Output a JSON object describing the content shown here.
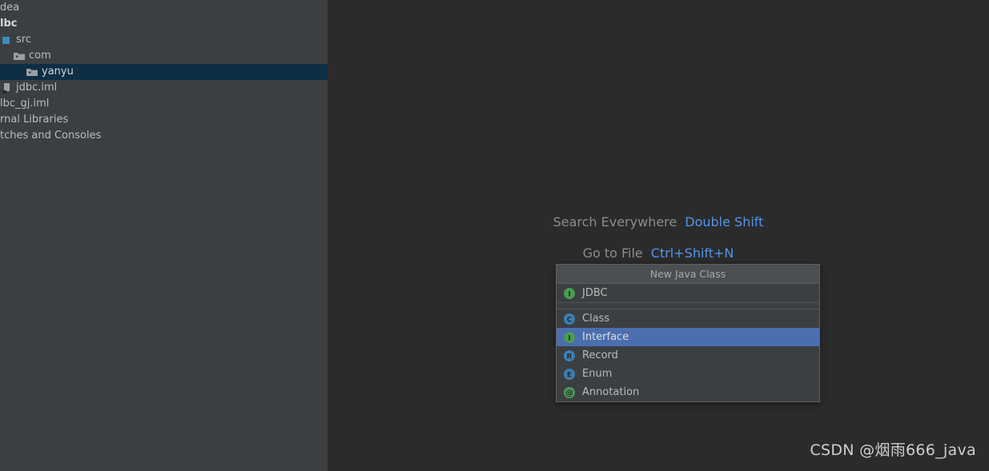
{
  "colors": {
    "panel_bg": "#3c3f41",
    "editor_bg": "#2b2b2b",
    "tree_selection": "#0d2e45",
    "menu_selection": "#4b6eaf",
    "menu_header_bg": "#4b4f53",
    "accent_link": "#5394ec",
    "text_primary": "#bbbbbb",
    "icon_green": "#499c54",
    "icon_blue": "#3b7fb5"
  },
  "project_tree": {
    "items": [
      {
        "label": "dea",
        "icon": "none",
        "indent": 0,
        "selected": false,
        "bold": false
      },
      {
        "label": "lbc",
        "icon": "none",
        "indent": 0,
        "selected": false,
        "bold": true
      },
      {
        "label": "src",
        "icon": "source-root-icon",
        "indent": 0,
        "selected": false,
        "bold": false
      },
      {
        "label": "com",
        "icon": "folder-icon",
        "indent": 1,
        "selected": false,
        "bold": false
      },
      {
        "label": "yanyu",
        "icon": "folder-icon",
        "indent": 2,
        "selected": true,
        "bold": false
      },
      {
        "label": "jdbc.iml",
        "icon": "module-file-icon",
        "indent": 0,
        "selected": false,
        "bold": false
      },
      {
        "label": "lbc_gj.iml",
        "icon": "none",
        "indent": 0,
        "selected": false,
        "bold": false
      },
      {
        "label": "rnal Libraries",
        "icon": "none",
        "indent": 0,
        "selected": false,
        "bold": false
      },
      {
        "label": "tches and Consoles",
        "icon": "none",
        "indent": 0,
        "selected": false,
        "bold": false
      }
    ]
  },
  "editor_hints": [
    {
      "name": "Search Everywhere",
      "shortcut": "Double Shift"
    },
    {
      "name": "Go to File",
      "shortcut": "Ctrl+Shift+N"
    }
  ],
  "popup": {
    "title": "New Java Class",
    "groups": [
      {
        "items": [
          {
            "label": "JDBC",
            "icon": "interface-icon",
            "icon_color": "#499c54",
            "glyph": "I",
            "selected": false
          }
        ]
      },
      {
        "items": [
          {
            "label": "Class",
            "icon": "class-icon",
            "icon_color": "#3b7fb5",
            "glyph": "C",
            "selected": false
          },
          {
            "label": "Interface",
            "icon": "interface-icon",
            "icon_color": "#499c54",
            "glyph": "I",
            "selected": true
          },
          {
            "label": "Record",
            "icon": "record-icon",
            "icon_color": "#3b7fb5",
            "glyph": "R",
            "selected": false
          },
          {
            "label": "Enum",
            "icon": "enum-icon",
            "icon_color": "#3b7fb5",
            "glyph": "E",
            "selected": false
          },
          {
            "label": "Annotation",
            "icon": "annotation-icon",
            "icon_color": "#499c54",
            "glyph": "@",
            "selected": false
          }
        ]
      }
    ]
  },
  "watermark": {
    "text": "CSDN @烟雨666_java"
  }
}
